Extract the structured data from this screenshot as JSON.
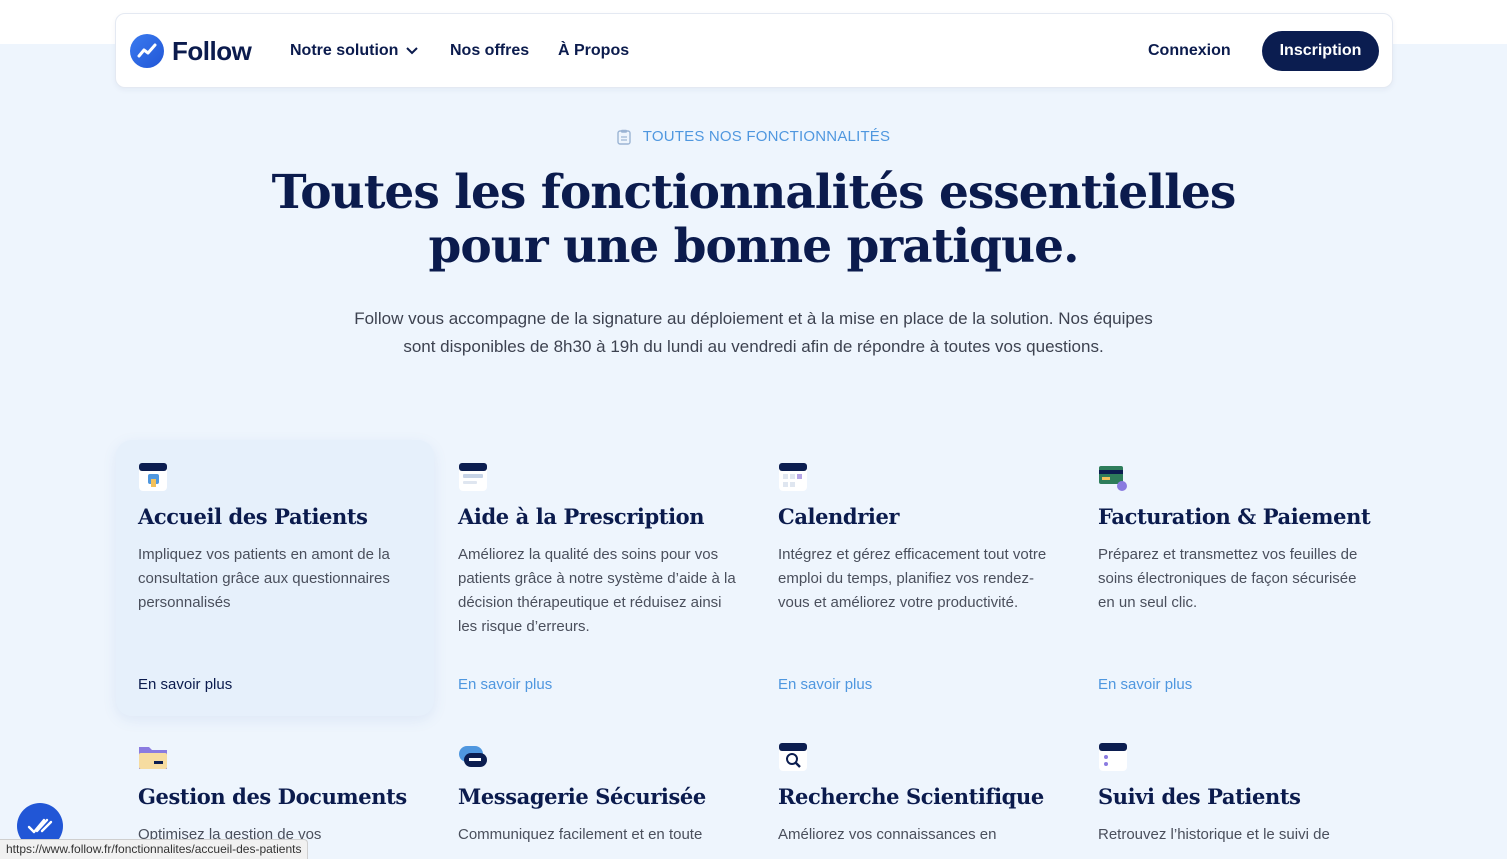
{
  "nav": {
    "logo_text": "Follow",
    "items": [
      {
        "label": "Notre solution",
        "has_dropdown": true
      },
      {
        "label": "Nos offres"
      },
      {
        "label": "À Propos"
      }
    ],
    "login_label": "Connexion",
    "signup_label": "Inscription"
  },
  "hero": {
    "eyebrow": "TOUTES NOS FONCTIONNALITÉS",
    "title_line1": "Toutes les fonctionnalités essentielles",
    "title_line2": "pour une bonne pratique.",
    "intro_line1": "Follow vous accompagne de la signature au déploiement et à la mise en place de la solution. Nos équipes",
    "intro_line2": "sont disponibles de 8h30 à 19h du lundi au vendredi afin de répondre à toutes vos questions."
  },
  "features": [
    {
      "title": "Accueil des Patients",
      "desc": "Impliquez vos patients en amont de la consultation grâce aux questionnaires personnalisés",
      "link": "En savoir plus",
      "icon": "patient-welcome-icon"
    },
    {
      "title": "Aide à la Prescription",
      "desc": "Améliorez la qualité des soins pour vos patients grâce à notre système d’aide à la décision thérapeutique et réduisez ainsi les risque d’erreurs.",
      "link": "En savoir plus",
      "icon": "prescription-icon"
    },
    {
      "title": "Calendrier",
      "desc": "Intégrez et gérez efficacement tout votre emploi du temps, planifiez vos rendez-vous et améliorez votre productivité.",
      "link": "En savoir plus",
      "icon": "calendar-icon"
    },
    {
      "title": "Facturation & Paiement",
      "desc": "Préparez et transmettez vos feuilles de soins électroniques de façon sécurisée en un seul clic.",
      "link": "En savoir plus",
      "icon": "billing-icon"
    },
    {
      "title": "Gestion des Documents",
      "desc": "Optimisez la gestion de vos",
      "icon": "folder-icon"
    },
    {
      "title": "Messagerie Sécurisée",
      "desc": "Communiquez facilement et en toute",
      "icon": "chat-icon"
    },
    {
      "title": "Recherche Scientifique",
      "desc": "Améliorez vos connaissances en",
      "icon": "research-icon"
    },
    {
      "title": "Suivi des Patients",
      "desc": "Retrouvez l’historique et le suivi de",
      "icon": "patient-tracking-icon"
    }
  ],
  "status_bar": {
    "url": "https://www.follow.fr/fonctionnalites/accueil-des-patients"
  },
  "colors": {
    "navy": "#0b1d50",
    "accent": "#4f97df",
    "background": "#eef5fd"
  }
}
